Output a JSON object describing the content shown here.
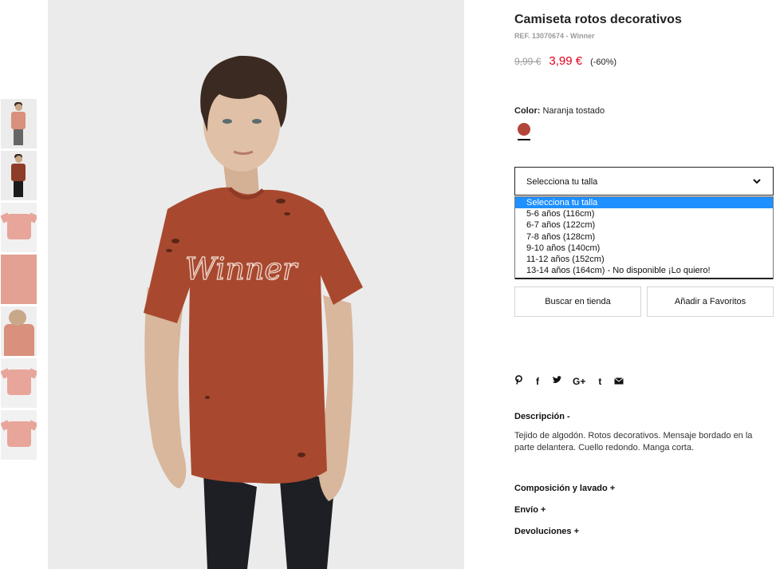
{
  "product": {
    "title": "Camiseta rotos decorativos",
    "ref": "REF. 13070674 - Winner",
    "price_old": "9,99 €",
    "price_new": "3,99 €",
    "discount": "(-60%)",
    "color_label": "Color:",
    "color_name": "Naranja tostado",
    "swatch_color": "#b3463a",
    "print_text": "Winner"
  },
  "size_select": {
    "placeholder": "Selecciona tu talla",
    "options": [
      "Selecciona tu talla",
      "5-6 años (116cm)",
      "6-7 años (122cm)",
      "7-8 años (128cm)",
      "9-10 años (140cm)",
      "11-12 años (152cm)",
      "13-14 años (164cm) - No disponible ¡Lo quiero!"
    ]
  },
  "buttons": {
    "store": "Buscar en tienda",
    "favorites": "Añadir a Favoritos"
  },
  "social": [
    "pinterest-icon",
    "facebook-icon",
    "twitter-icon",
    "google-plus-icon",
    "tumblr-icon",
    "email-icon"
  ],
  "social_glyphs": [
    "℗",
    "f",
    "🐦",
    "G+",
    "t",
    "✉"
  ],
  "description": {
    "heading": "Descripción  -",
    "text": "Tejido de algodón. Rotos decorativos. Mensaje bordado en la parte delantera. Cuello redondo. Manga corta."
  },
  "accordions": {
    "composition": "Composición y lavado  +",
    "shipping": "Envío  +",
    "returns": "Devoluciones  +"
  },
  "colors": {
    "accent_price": "#e3001b",
    "selected_option": "#1e90ff",
    "tshirt": "#a8492f"
  }
}
